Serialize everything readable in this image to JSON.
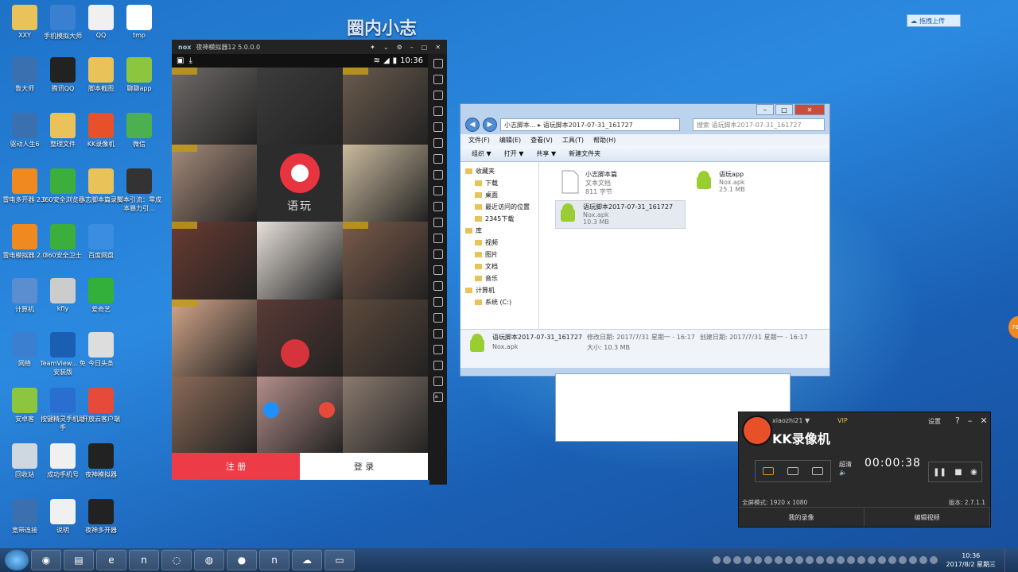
{
  "desktop": {
    "overlay_title": "圈内小志",
    "upload_label": "拖拽上传",
    "icons": [
      {
        "label": "XXY",
        "color": "#e9c25a"
      },
      {
        "label": "手机模拟大师",
        "color": "#3a7fd0"
      },
      {
        "label": "QQ",
        "color": "#f0f0f0"
      },
      {
        "label": "tmp",
        "color": "#ffffff"
      },
      {
        "label": "鲁大师",
        "color": "#3a6fb0"
      },
      {
        "label": "腾讯QQ",
        "color": "#222222"
      },
      {
        "label": "脚本截图",
        "color": "#e9c25a"
      },
      {
        "label": "聊聊app",
        "color": "#8cc63f"
      },
      {
        "label": "驱动人生6",
        "color": "#3a6fb0"
      },
      {
        "label": "整理文件",
        "color": "#e9c25a"
      },
      {
        "label": "KK录像机",
        "color": "#e8502a"
      },
      {
        "label": "微信",
        "color": "#4caf50"
      },
      {
        "label": "雷电多开器 2.0",
        "color": "#f08a20"
      },
      {
        "label": "360安全浏览器",
        "color": "#3cae3c"
      },
      {
        "label": "小志脚本篇录制",
        "color": "#e9c25a"
      },
      {
        "label": "脚本引流：零成本暴力引...",
        "color": "#333333"
      },
      {
        "label": "雷电模拟器 2.0",
        "color": "#f08a20"
      },
      {
        "label": "360安全卫士",
        "color": "#3cae3c"
      },
      {
        "label": "百度网盘",
        "color": "#3a8de0"
      },
      {
        "label": "计算机",
        "color": "#5a8ed0"
      },
      {
        "label": "kfly",
        "color": "#ccc"
      },
      {
        "label": "爱奇艺",
        "color": "#33b03a"
      },
      {
        "label": "网络",
        "color": "#3a7fd0"
      },
      {
        "label": "TeamView... 免安装版",
        "color": "#1a5fb4"
      },
      {
        "label": "今日头条",
        "color": "#ddd"
      },
      {
        "label": "安卓客",
        "color": "#8cc63f"
      },
      {
        "label": "按键精灵手机助手",
        "color": "#2a6fd0"
      },
      {
        "label": "开放云客户端",
        "color": "#e84a3a"
      },
      {
        "label": "回收站",
        "color": "#cfd8e0"
      },
      {
        "label": "成功手机号",
        "color": "#f0f0f0"
      },
      {
        "label": "夜神模拟器",
        "color": "#222"
      },
      {
        "label": "宽带连接",
        "color": "#3a6fb0"
      },
      {
        "label": "说明",
        "color": "#f0f0f0"
      },
      {
        "label": "夜神多开器",
        "color": "#222"
      }
    ]
  },
  "nox": {
    "title": "夜神模拟器12 5.0.0.0",
    "time": "10:36",
    "app_logo_text": "语玩",
    "register": "注 册",
    "login": "登 录",
    "cells": [
      "#6e6a68",
      "#3c3c3c",
      "#6b5c4e",
      "#a58b7a",
      "center",
      "#cabb9e",
      "#6a3b32",
      "#e6e0da",
      "#7a5b4a",
      "#d4a689",
      "#5a3a36",
      "#5c4a3c",
      "#8a6a58",
      "#b38e8a",
      "#8a7a6e"
    ]
  },
  "explorer": {
    "address": "小志脚本... ▸ 语玩脚本2017-07-31_161727",
    "search": "搜索 语玩脚本2017-07-31_161727",
    "menu": [
      "文件(F)",
      "编辑(E)",
      "查看(V)",
      "工具(T)",
      "帮助(H)"
    ],
    "toolbar": [
      "组织 ▼",
      "打开 ▼",
      "共享 ▼",
      "新建文件夹"
    ],
    "nav": [
      "收藏夹",
      "下载",
      "桌面",
      "最近访问的位置",
      "2345下载",
      "库",
      "视频",
      "图片",
      "文档",
      "音乐",
      "计算机",
      "系统 (C:)"
    ],
    "files": [
      {
        "name": "小志脚本篇",
        "type": "文本文档",
        "size": "811 字节"
      },
      {
        "name": "语玩app",
        "type": "Nox.apk",
        "size": "25.1 MB"
      },
      {
        "name": "语玩脚本2017-07-31_161727",
        "type": "Nox.apk",
        "size": "10.3 MB"
      }
    ],
    "details": {
      "name": "语玩脚本2017-07-31_161727",
      "type": "Nox.apk",
      "modified": "修改日期: 2017/7/31 星期一 - 16:17",
      "created": "创建日期: 2017/7/31 星期一 - 16:17",
      "size": "大小: 10.3 MB"
    }
  },
  "kk": {
    "user": "xiaozhi21 ▼",
    "vip": "VIP",
    "title": "KK录像机",
    "settings": "设置",
    "quality": "超清",
    "time": "00:00:38",
    "fullscreen": "全屏模式: 1920 x 1080",
    "version": "版本: 2.7.1.1",
    "my_recordings": "我的录像",
    "edit_video": "编辑视频"
  },
  "taskbar": {
    "clock_time": "10:36",
    "clock_date": "2017/8/2 星期三",
    "side_bubble": "76"
  }
}
